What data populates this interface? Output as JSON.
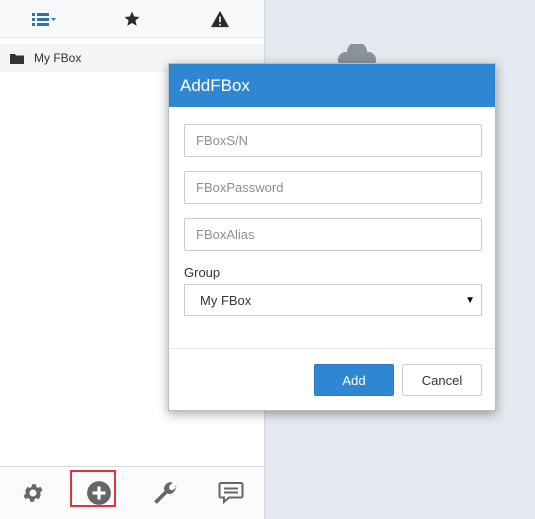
{
  "sidebar": {
    "tree": [
      {
        "label": "My FBox"
      }
    ],
    "top_toolbar": [
      "list-menu-icon",
      "star-icon",
      "warning-icon"
    ],
    "bottom_toolbar": [
      "gear-icon",
      "plus-circle-icon",
      "wrench-icon",
      "chat-icon"
    ],
    "active_bottom": "plus-circle-icon"
  },
  "dialog": {
    "title": "AddFBox",
    "fields": {
      "sn_placeholder": "FBoxS/N",
      "password_placeholder": "FBoxPassword",
      "alias_placeholder": "FBoxAlias"
    },
    "group_label": "Group",
    "group_selected": "My FBox",
    "add_label": "Add",
    "cancel_label": "Cancel"
  },
  "colors": {
    "accent": "#2f87d4",
    "highlight_border": "#d9343b"
  }
}
